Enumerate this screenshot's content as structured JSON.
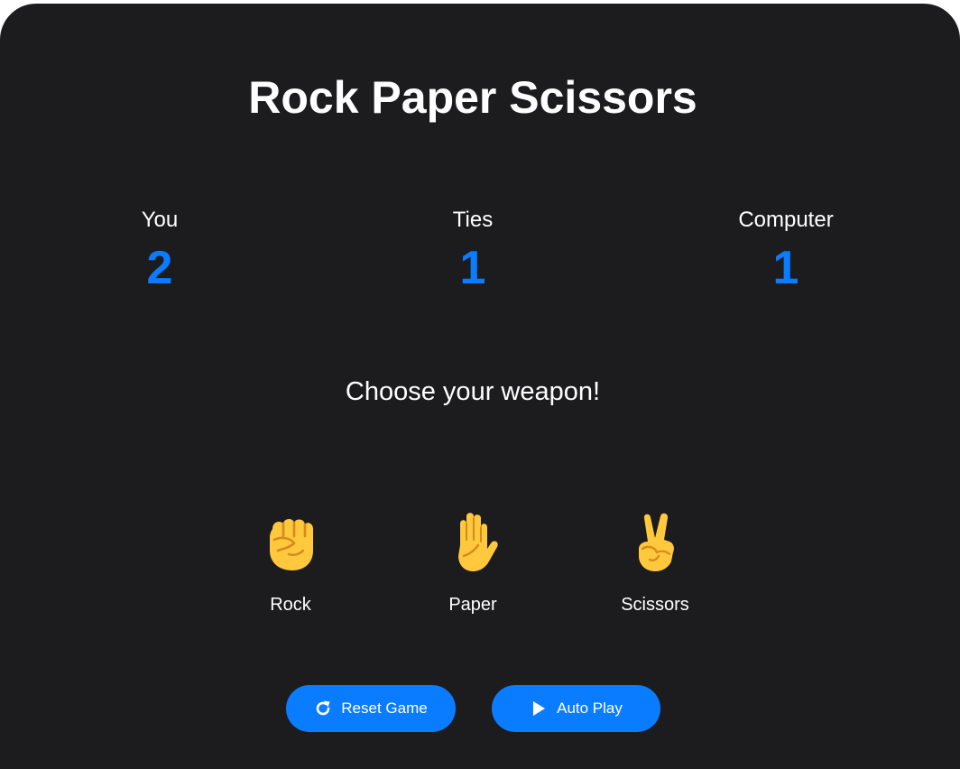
{
  "title": "Rock Paper Scissors",
  "scores": {
    "you": {
      "label": "You",
      "value": "2"
    },
    "ties": {
      "label": "Ties",
      "value": "1"
    },
    "computer": {
      "label": "Computer",
      "value": "1"
    }
  },
  "prompt": "Choose your weapon!",
  "choices": [
    {
      "label": "Rock",
      "icon": "raised-fist-icon"
    },
    {
      "label": "Paper",
      "icon": "raised-hand-icon"
    },
    {
      "label": "Scissors",
      "icon": "victory-hand-icon"
    }
  ],
  "buttons": {
    "reset": {
      "label": "Reset Game",
      "icon": "restart-icon"
    },
    "auto": {
      "label": "Auto Play",
      "icon": "play-icon"
    }
  },
  "colors": {
    "background": "#1c1c1e",
    "accent": "#0a7cff",
    "text": "#ffffff",
    "emoji_skin": "#ffc83d",
    "emoji_shade": "#d68a1c"
  }
}
